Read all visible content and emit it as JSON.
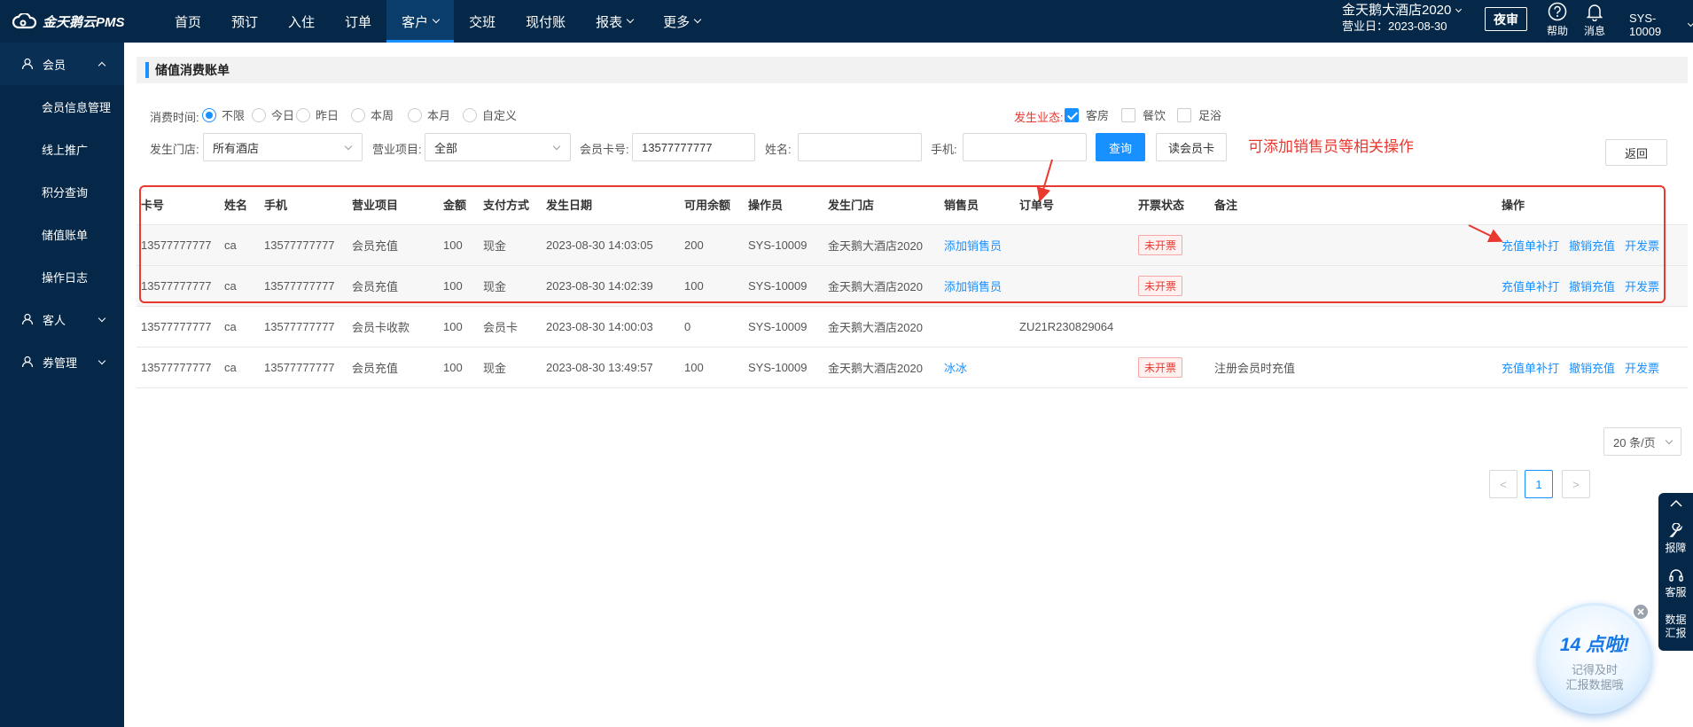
{
  "app": {
    "logo_text": "金天鹅云PMS",
    "nav": [
      {
        "label": "首页",
        "has_caret": false
      },
      {
        "label": "预订",
        "has_caret": false
      },
      {
        "label": "入住",
        "has_caret": false
      },
      {
        "label": "订单",
        "has_caret": false
      },
      {
        "label": "客户",
        "has_caret": true,
        "active": true
      },
      {
        "label": "交班",
        "has_caret": false
      },
      {
        "label": "现付账",
        "has_caret": false
      },
      {
        "label": "报表",
        "has_caret": true
      },
      {
        "label": "更多",
        "has_caret": true
      }
    ],
    "hotel_name": "金天鹅大酒店2020",
    "business_day": "营业日：2023-08-30",
    "night_audit_label": "夜审",
    "help_label": "帮助",
    "message_label": "消息",
    "user": "SYS-10009"
  },
  "sidebar": {
    "groups": [
      {
        "label": "会员",
        "expanded": true,
        "items": [
          "会员信息管理",
          "线上推广",
          "积分查询",
          "储值账单",
          "操作日志"
        ]
      },
      {
        "label": "客人",
        "expanded": false
      },
      {
        "label": "券管理",
        "expanded": false
      }
    ]
  },
  "page": {
    "title": "储值消费账单",
    "filters": {
      "time_label": "消费时间:",
      "time_options": [
        "不限",
        "今日",
        "昨日",
        "本周",
        "本月",
        "自定义"
      ],
      "time_selected": "不限",
      "biz_label": "发生业态:",
      "biz_options": [
        {
          "label": "客房",
          "checked": true
        },
        {
          "label": "餐饮",
          "checked": false
        },
        {
          "label": "足浴",
          "checked": false
        }
      ],
      "store_label": "发生门店:",
      "store_value": "所有酒店",
      "project_label": "营业项目:",
      "project_value": "全部",
      "card_label": "会员卡号:",
      "card_value": "13577777777",
      "name_label": "姓名:",
      "name_value": "",
      "phone_label": "手机:",
      "phone_value": "",
      "query_button": "查询",
      "read_card_button": "读会员卡",
      "back_button": "返回"
    },
    "annotation": "可添加销售员等相关操作",
    "table": {
      "columns": [
        "卡号",
        "姓名",
        "手机",
        "营业项目",
        "金额",
        "支付方式",
        "发生日期",
        "可用余额",
        "操作员",
        "发生门店",
        "销售员",
        "订单号",
        "开票状态",
        "备注",
        "操作"
      ],
      "rows": [
        {
          "card": "13577777777",
          "name": "ca",
          "phone": "13577777777",
          "project": "会员充值",
          "amount": "100",
          "pay": "现金",
          "date": "2023-08-30 14:03:05",
          "balance": "200",
          "operator": "SYS-10009",
          "store": "金天鹅大酒店2020",
          "seller": "添加销售员",
          "seller_link": true,
          "order": "",
          "invoice": "未开票",
          "remark": "",
          "ops": [
            "充值单补打",
            "撤销充值",
            "开发票"
          ]
        },
        {
          "card": "13577777777",
          "name": "ca",
          "phone": "13577777777",
          "project": "会员充值",
          "amount": "100",
          "pay": "现金",
          "date": "2023-08-30 14:02:39",
          "balance": "100",
          "operator": "SYS-10009",
          "store": "金天鹅大酒店2020",
          "seller": "添加销售员",
          "seller_link": true,
          "order": "",
          "invoice": "未开票",
          "remark": "",
          "ops": [
            "充值单补打",
            "撤销充值",
            "开发票"
          ]
        },
        {
          "card": "13577777777",
          "name": "ca",
          "phone": "13577777777",
          "project": "会员卡收款",
          "amount": "100",
          "pay": "会员卡",
          "date": "2023-08-30 14:00:03",
          "balance": "0",
          "operator": "SYS-10009",
          "store": "金天鹅大酒店2020",
          "seller": "",
          "seller_link": false,
          "order": "ZU21R230829064",
          "invoice": "",
          "remark": "",
          "ops": []
        },
        {
          "card": "13577777777",
          "name": "ca",
          "phone": "13577777777",
          "project": "会员充值",
          "amount": "100",
          "pay": "现金",
          "date": "2023-08-30 13:49:57",
          "balance": "100",
          "operator": "SYS-10009",
          "store": "金天鹅大酒店2020",
          "seller": "冰冰",
          "seller_link": true,
          "order": "",
          "invoice": "未开票",
          "remark": "注册会员时充值",
          "ops": [
            "充值单补打",
            "撤销充值",
            "开发票"
          ]
        }
      ]
    },
    "pagination": {
      "prev": "<",
      "current": "1",
      "next": ">",
      "page_size": "20 条/页"
    }
  },
  "float_bar": {
    "items": [
      "报障",
      "客服",
      "数据汇报"
    ]
  },
  "reminder": {
    "title": "14 点啦!",
    "line1": "记得及时",
    "line2": "汇报数据哦"
  },
  "colors": {
    "topbar": "#062848",
    "accent": "#1890ff",
    "alert": "#e8382f"
  }
}
